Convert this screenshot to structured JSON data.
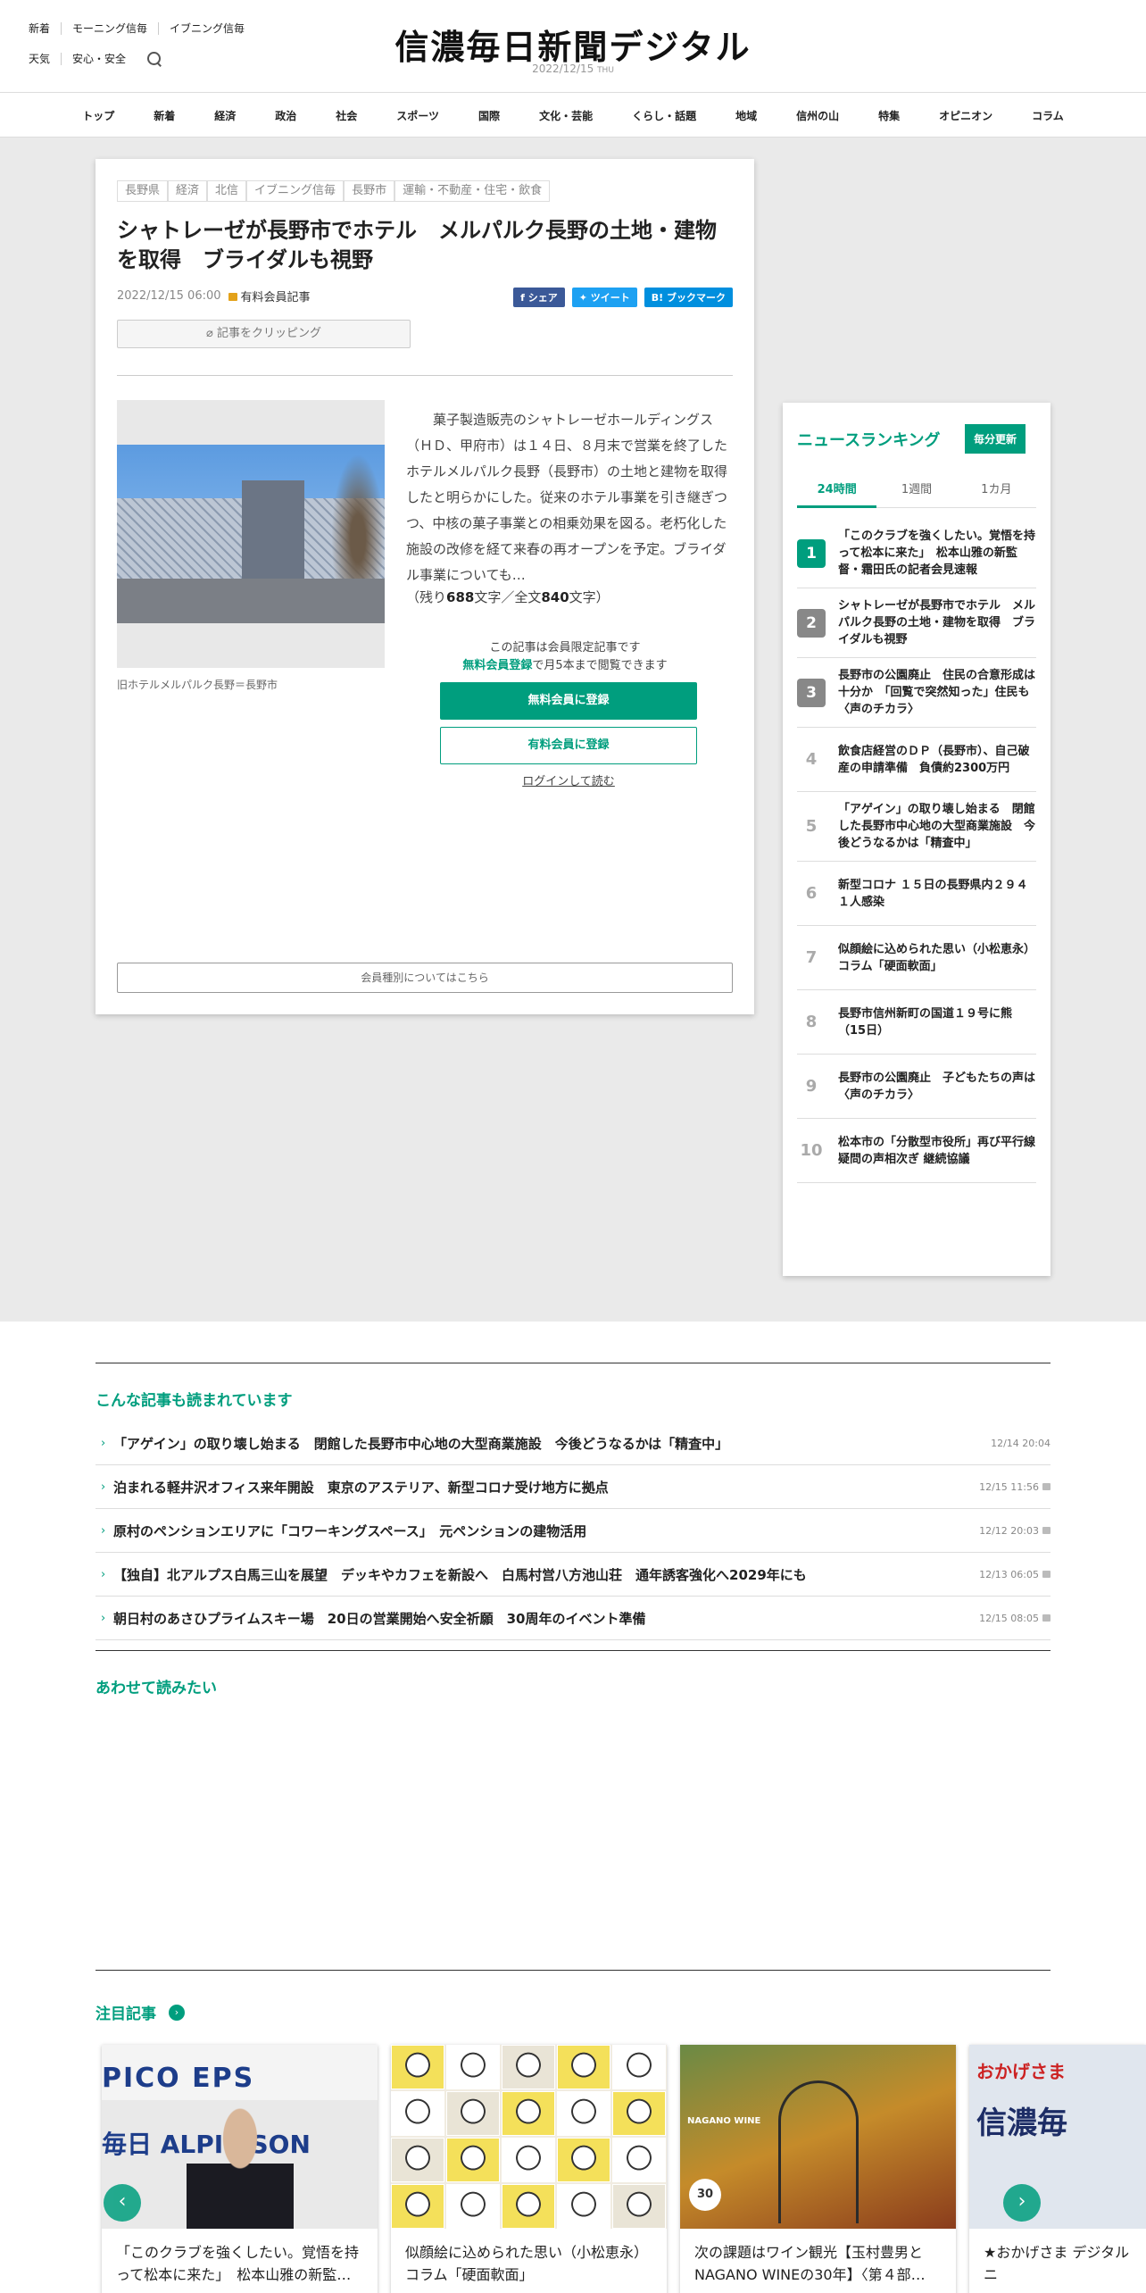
{
  "header": {
    "links_row1": [
      "新着",
      "モーニング信毎",
      "イブニング信毎"
    ],
    "links_row2": [
      "天気",
      "安心・安全"
    ],
    "logo": "信濃毎日新聞デジタル",
    "date": "2022/12/15",
    "day": "THU"
  },
  "nav": [
    "トップ",
    "新着",
    "経済",
    "政治",
    "社会",
    "スポーツ",
    "国際",
    "文化・芸能",
    "くらし・話題",
    "地域",
    "信州の山",
    "特集",
    "オピニオン",
    "コラム"
  ],
  "article": {
    "tags": [
      "長野県",
      "経済",
      "北信",
      "イブニング信毎",
      "長野市",
      "運輸・不動産・住宅・飲食"
    ],
    "title": "シャトレーゼが長野市でホテル　メルパルク長野の土地・建物を取得　ブライダルも視野",
    "datetime": "2022/12/15 06:00",
    "paid_label": "有料会員記事",
    "share": {
      "facebook": "シェア",
      "twitter": "ツイート",
      "hatena": "ブックマーク"
    },
    "clip_label": "記事をクリッピング",
    "photo_caption": "旧ホテルメルパルク長野＝長野市",
    "body": "菓子製造販売のシャトレーゼホールディングス（ＨＤ、甲府市）は１４日、８月末で営業を終了したホテルメルパルク長野（長野市）の土地と建物を取得したと明らかにした。従来のホテル事業を引き継ぎつつ、中核の菓子事業との相乗効果を図る。老朽化した施設の改修を経て来春の再オープンを予定。ブライダル事業についても…",
    "remain_prefix": "（残り",
    "remain_count": "688",
    "remain_mid": "文字／全文",
    "total_count": "840",
    "remain_suffix": "文字）",
    "members_note_line1": "この記事は会員限定記事です",
    "members_note_link": "無料会員登録",
    "members_note_line2": "で月5本まで閲覧できます",
    "free_register": "無料会員に登録",
    "paid_register": "有料会員に登録",
    "login": "ログインして読む",
    "member_types": "会員種別についてはこちら"
  },
  "ranking": {
    "title": "ニュースランキング",
    "badge": "毎分更新",
    "tabs": [
      "24時間",
      "1週間",
      "1カ月"
    ],
    "items": [
      {
        "num": "1",
        "text": "「このクラブを強くしたい。覚悟を持って松本に来た」　松本山雅の新監督・霜田氏の記者会見速報"
      },
      {
        "num": "2",
        "text": "シャトレーゼが長野市でホテル　メルパルク長野の土地・建物を取得　ブライダルも視野"
      },
      {
        "num": "3",
        "text": "長野市の公園廃止　住民の合意形成は十分か　「回覧で突然知った」住民も〈声のチカラ〉"
      },
      {
        "num": "4",
        "text": "飲食店経営のＤＰ（長野市）、自己破産の申請準備　負債約2300万円"
      },
      {
        "num": "5",
        "text": "「アゲイン」の取り壊し始まる　閉館した長野市中心地の大型商業施設　今後どうなるかは「精査中」"
      },
      {
        "num": "6",
        "text": "新型コロナ １５日の長野県内２９４１人感染"
      },
      {
        "num": "7",
        "text": "似顔絵に込められた思い（小松恵永）コラム「硬面軟面」"
      },
      {
        "num": "8",
        "text": "長野市信州新町の国道１９号に熊（15日）"
      },
      {
        "num": "9",
        "text": "長野市の公園廃止　子どもたちの声は〈声のチカラ〉"
      },
      {
        "num": "10",
        "text": "松本市の「分散型市役所」再び平行線　疑問の声相次ぎ 継続協議"
      }
    ],
    "top_colors": [
      "#009e7e",
      "#888888",
      "#888888"
    ]
  },
  "also_read": {
    "title": "こんな記事も読まれています",
    "items": [
      {
        "text": "「アゲイン」の取り壊し始まる　閉館した長野市中心地の大型商業施設　今後どうなるかは「精査中」",
        "date": "12/14 20:04",
        "locked": false
      },
      {
        "text": "泊まれる軽井沢オフィス来年開設　東京のアステリア、新型コロナ受け地方に拠点",
        "date": "12/15 11:56",
        "locked": true
      },
      {
        "text": "原村のペンションエリアに「コワーキングスペース」　元ペンションの建物活用",
        "date": "12/12 20:03",
        "locked": true
      },
      {
        "text": "【独自】北アルプス白馬三山を展望　デッキやカフェを新設へ　白馬村営八方池山荘　通年誘客強化へ2029年にも",
        "date": "12/13 06:05",
        "locked": true
      },
      {
        "text": "朝日村のあさひプライムスキー場　20日の営業開始へ安全祈願　30周年のイベント準備",
        "date": "12/15 08:05",
        "locked": true
      }
    ]
  },
  "read_together": {
    "title": "あわせて読みたい"
  },
  "featured": {
    "title": "注目記事",
    "cards": [
      {
        "text": "「このクラブを強くしたい。覚悟を持って松本に来た」　松本山雅の新監…",
        "img_text1": "PICO  EPS",
        "img_text2": "毎日  ALPI  PSON"
      },
      {
        "text": "似顔絵に込められた思い（小松恵永）コラム「硬面軟面」"
      },
      {
        "text": "次の課題はワイン観光【玉村豊男とNAGANO WINEの30年】〈第４部…",
        "img_text1": "NAGANO WINE",
        "img_text2": "30"
      },
      {
        "text": "★おかげさま デジタルニ",
        "img_text1": "おかげさま",
        "img_text2": "信濃毎"
      }
    ]
  },
  "colors": {
    "accent": "#009e7e",
    "lock": "#e3a21a"
  }
}
